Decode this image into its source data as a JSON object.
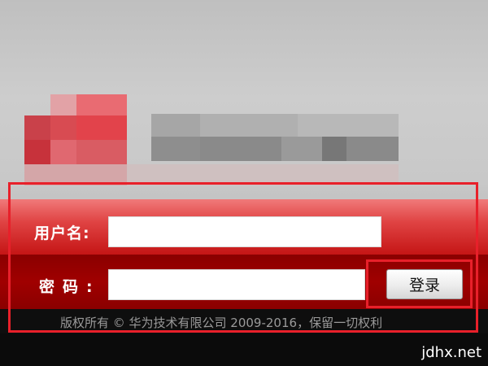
{
  "colors": {
    "panel_top": "#e04444",
    "panel_bottom": "#a00000",
    "annotation": "#e8202a",
    "footer_bg": "#0e0e0e"
  },
  "login": {
    "username_label": "用户名",
    "username_colon": ":",
    "username_value": "",
    "password_label": "密码",
    "password_colon": ":",
    "password_value": "",
    "submit_label": "登录"
  },
  "footer": {
    "copyright": "版权所有 © 华为技术有限公司 2009-2016，保留一切权利"
  },
  "watermark": "jdhx.net"
}
